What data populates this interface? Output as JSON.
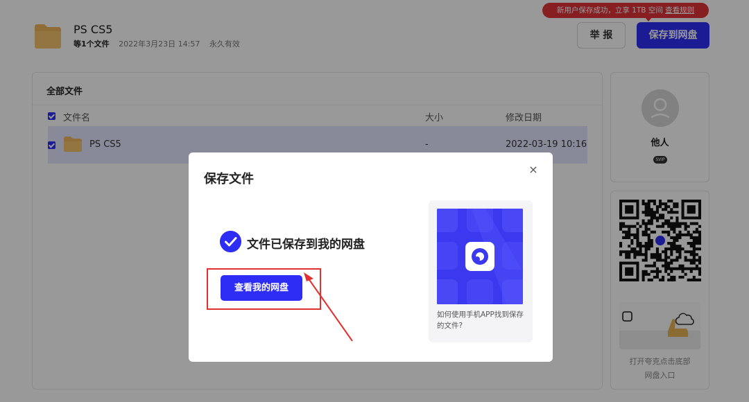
{
  "file_header": {
    "title": "PS CS5",
    "count": "等1个文件",
    "date": "2022年3月23日 14:57",
    "validity": "永久有效"
  },
  "promo": {
    "text": "新用户保存成功，立享 1TB 空间 ",
    "link": "查看规则"
  },
  "actions": {
    "report": "举 报",
    "save": "保存到网盘"
  },
  "files_panel": {
    "title": "全部文件",
    "columns": {
      "name": "文件名",
      "size": "大小",
      "date": "修改日期"
    },
    "rows": [
      {
        "name": "PS CS5",
        "size": "-",
        "date": "2022-03-19 10:16"
      }
    ]
  },
  "user": {
    "name": "他人",
    "badge": "SVIP"
  },
  "qr": {
    "caption_line1": "打开夸克点击底部",
    "caption_line2": "网盘入口"
  },
  "modal": {
    "title": "保存文件",
    "close": "×",
    "success_text": "文件已保存到我的网盘",
    "view_button": "查看我的网盘",
    "app_caption": "如何使用手机APP找到保存的文件?"
  },
  "colors": {
    "accent": "#2d2df5",
    "promo_red": "#e0333a",
    "highlight_red": "#e03030",
    "row_selected": "#e5e6ff"
  }
}
